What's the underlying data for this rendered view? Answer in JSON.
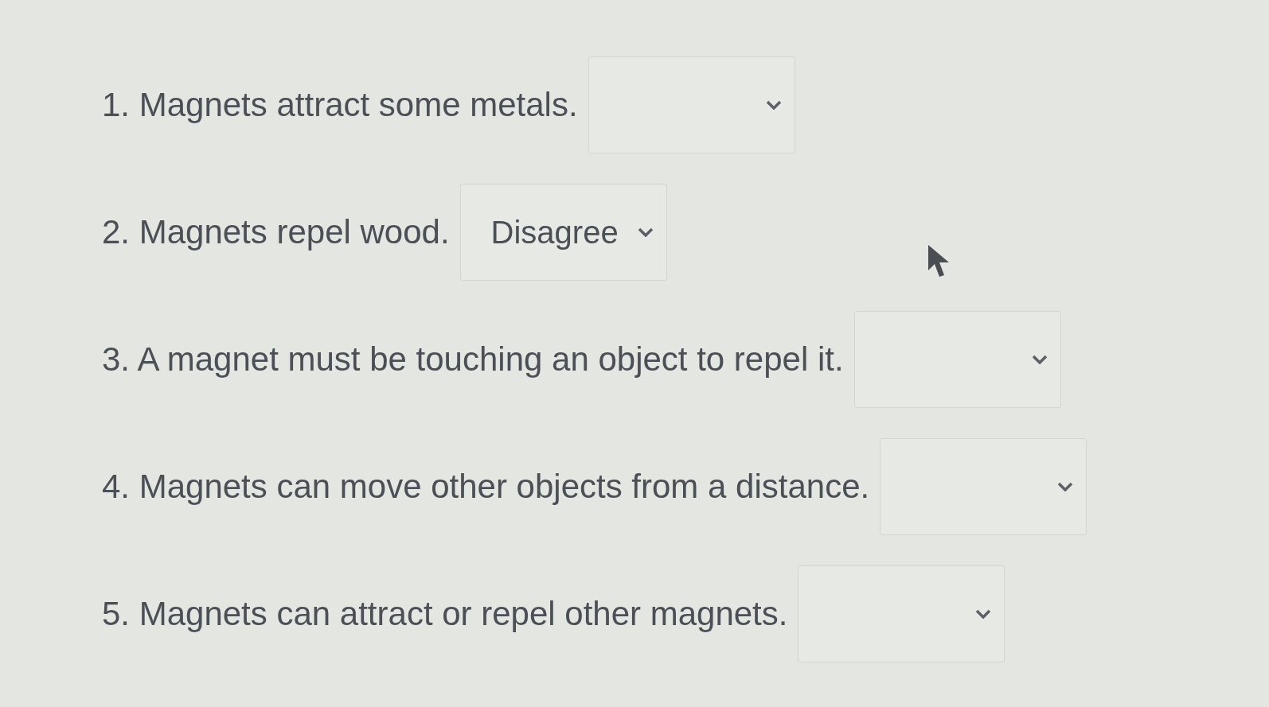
{
  "questions": [
    {
      "text": "1. Magnets attract some metals."
    },
    {
      "text": "2. Magnets repel wood.",
      "answer": "Disagree"
    },
    {
      "text": "3. A magnet must be touching an object to repel it."
    },
    {
      "text": "4. Magnets can move other objects from a distance."
    },
    {
      "text": "5. Magnets can attract or repel other magnets."
    }
  ]
}
